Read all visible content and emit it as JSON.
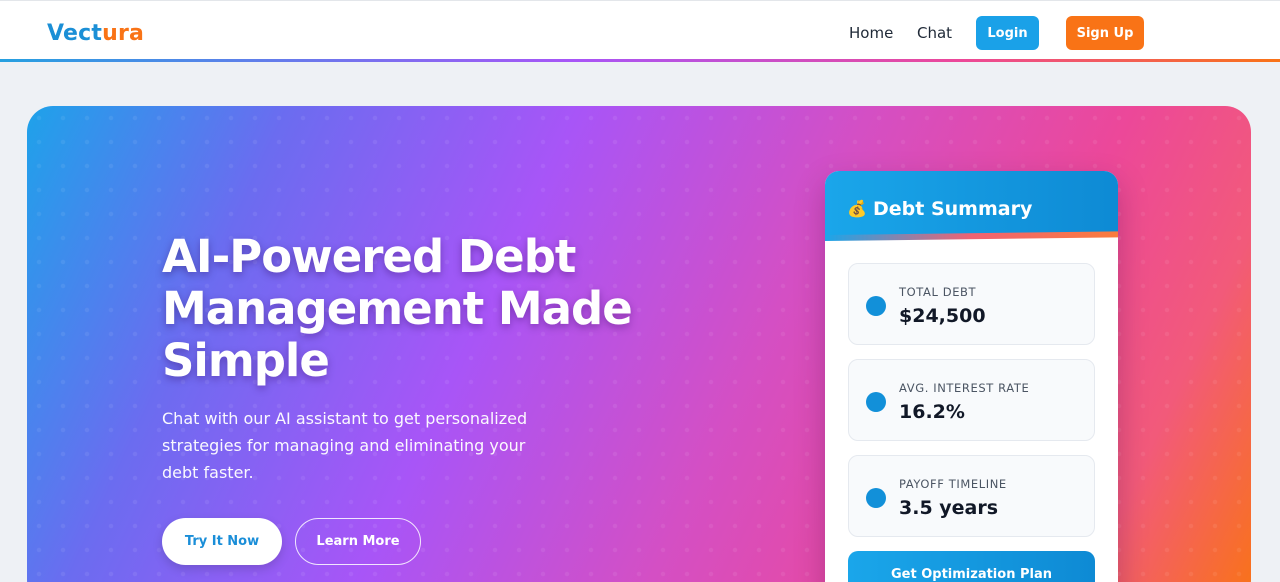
{
  "nav": {
    "logo_part1": "Vect",
    "logo_part2": "ura",
    "links": [
      "Home",
      "Chat"
    ],
    "login_label": "Login",
    "signup_label": "Sign Up"
  },
  "hero": {
    "title": "AI-Powered Debt Management Made Simple",
    "subtitle": "Chat with our AI assistant to get personalized strategies for managing and eliminating your debt faster.",
    "primary_cta": "Try It Now",
    "secondary_cta": "Learn More"
  },
  "summary_card": {
    "icon": "money-bag-icon",
    "title": "Debt Summary",
    "stats": [
      {
        "label": "TOTAL DEBT",
        "value": "$24,500"
      },
      {
        "label": "AVG. INTEREST RATE",
        "value": "16.2%"
      },
      {
        "label": "PAYOFF TIMELINE",
        "value": "3.5 years"
      }
    ],
    "action_label": "Get Optimization Plan"
  },
  "colors": {
    "brand_blue": "#1b8fd6",
    "brand_orange": "#f97316",
    "login_button": "#1aa1e8",
    "gradient": [
      "#1ea2ea",
      "#a855f7",
      "#ec4899",
      "#f97316"
    ]
  }
}
